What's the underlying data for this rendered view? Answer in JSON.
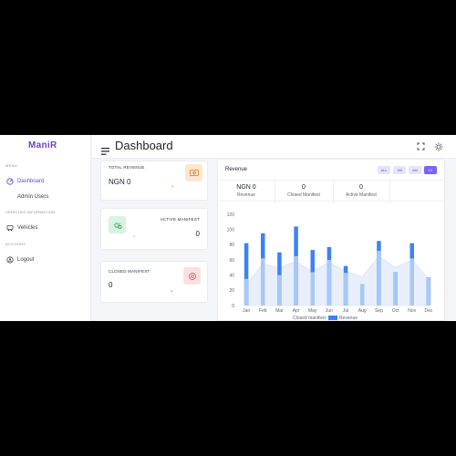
{
  "app": {
    "logo": "ManiR"
  },
  "sidebar": {
    "menu_label": "MENU",
    "dashboard": "Dashboard",
    "admin_users": "Admin Users",
    "vehicles_section": "VEHICLES INFORMATION",
    "vehicles": "Vehicles",
    "account_section": "ACCOUNT",
    "logout": "Logout"
  },
  "header": {
    "title": "Dashboard"
  },
  "stats": {
    "total_revenue": {
      "label": "TOTAL REVENUE",
      "value": "NGN 0"
    },
    "active_manifest": {
      "label": "ACTIVE MANIFEST",
      "value": "0"
    },
    "closed_manifest": {
      "label": "CLOSED MANIFEST",
      "value": "0"
    }
  },
  "revenue_panel": {
    "title": "Revenue",
    "filters": [
      "ALL",
      "1M",
      "6M",
      "1Y"
    ],
    "active_filter": "1Y",
    "summary": [
      {
        "value": "NGN 0",
        "label": "Revenue"
      },
      {
        "value": "0",
        "label": "Closed Manifest"
      },
      {
        "value": "0",
        "label": "Active Manifest"
      }
    ]
  },
  "colors": {
    "accent": "#7b61ff",
    "brand": "#6f42c1",
    "revenue_bar": "#3b82f6",
    "closed_bar": "#a8c8f8"
  },
  "icons": [
    "menu-icon",
    "fullscreen-icon",
    "sun-icon",
    "dashboard-icon",
    "vehicles-icon",
    "logout-icon",
    "money-icon",
    "manifest-icon",
    "settings-icon"
  ],
  "chart_data": {
    "type": "bar",
    "categories": [
      "Jan",
      "Feb",
      "Mar",
      "Apr",
      "May",
      "Jun",
      "Jul",
      "Aug",
      "Sep",
      "Oct",
      "Nov",
      "Dec"
    ],
    "series": [
      {
        "name": "Revenue",
        "values": [
          82,
          95,
          70,
          104,
          73,
          77,
          52,
          28,
          85,
          44,
          82,
          37
        ]
      },
      {
        "name": "Closed manifest",
        "values": [
          35,
          62,
          40,
          65,
          44,
          60,
          43,
          28,
          72,
          44,
          62,
          37
        ]
      }
    ],
    "area_values": [
      28,
      55,
      50,
      58,
      45,
      57,
      45,
      38,
      65,
      50,
      60,
      35
    ],
    "ylim": [
      0,
      120
    ],
    "yticks": [
      0,
      20,
      40,
      60,
      80,
      100,
      120
    ],
    "legend_position": "bottom"
  }
}
